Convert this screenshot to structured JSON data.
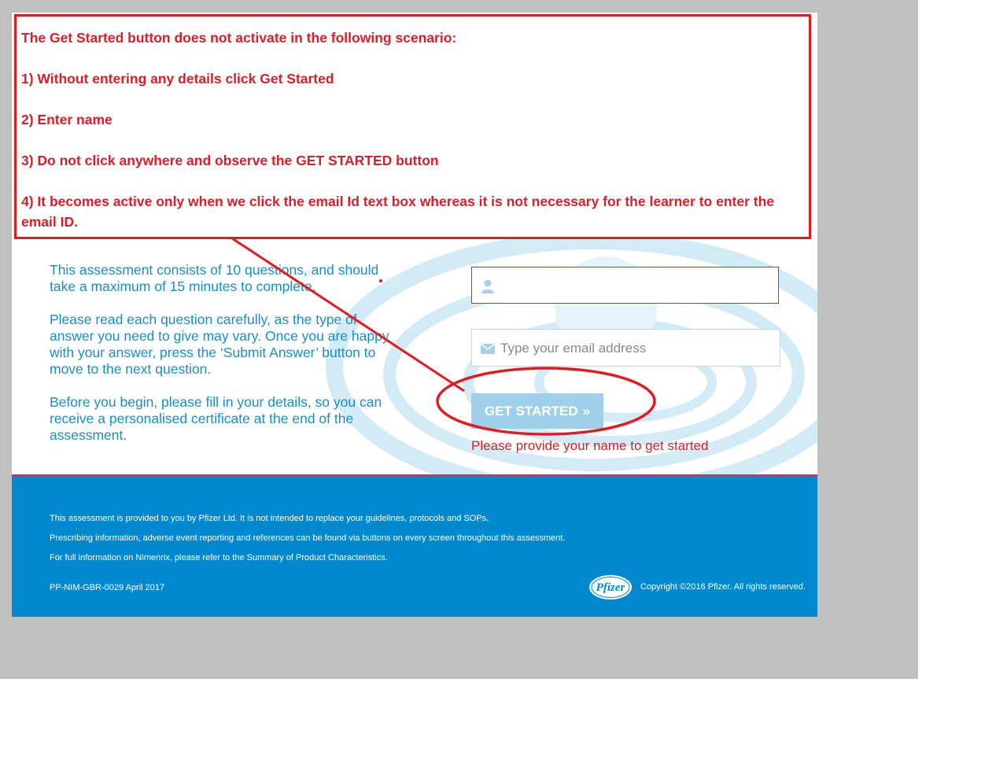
{
  "intro": {
    "p1": "This assessment consists of 10 questions, and should take a maximum of 15 minutes to complete.",
    "p2": "Please read each question carefully, as the type of answer you need to give may vary. Once you are happy with your answer, press the ‘Submit Answer’ button to move to the next question.",
    "p3": "Before you begin, please fill in your details, so you can receive a personalised certificate at the end of the assessment."
  },
  "form": {
    "name_value": "",
    "email_placeholder": "Type your email address",
    "get_started_label": "GET STARTED",
    "get_started_chevron": "»",
    "error_message": "Please provide your name to get started",
    "name_icon": "user-icon",
    "email_icon": "envelope-icon"
  },
  "footer": {
    "line1": "This assessment is provided to you by Pfizer Ltd. It is not intended to replace your guidelines, protocols and SOPs.",
    "line2": "Prescribing information, adverse event reporting and references can be found via buttons on every screen throughout this assessment.",
    "line3": "For full information on Nimenrix, please refer to the Summary of Product Characteristics.",
    "code": "PP-NIM-GBR-0029  April 2017",
    "logo_text": "Pfizer",
    "copyright": "Copyright ©2016 Pfizer. All rights reserved."
  },
  "annotation": {
    "title": "The Get Started button does not activate in the following scenario:",
    "step1": "1) Without entering any details click Get Started",
    "step2": "2) Enter name",
    "step3": "3) Do not click anywhere and observe the GET STARTED button",
    "step4": "4) It becomes active only when we click the email Id text box whereas it is not necessary for the learner to enter the email ID."
  },
  "colors": {
    "brand_blue": "#0089cf",
    "text_blue": "#1a8dc9",
    "error_red": "#d8202a",
    "disabled_button": "#9fcfe9",
    "accent_pink": "#d4287a"
  }
}
